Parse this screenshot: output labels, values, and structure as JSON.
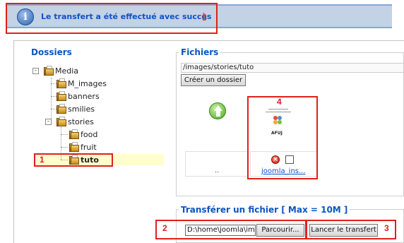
{
  "message": {
    "text": "Le transfert a été effectué avec succès",
    "icon": "info-icon"
  },
  "annotations": [
    "1",
    "2",
    "3",
    "4",
    "5"
  ],
  "dossiers": {
    "title": "Dossiers",
    "tree": {
      "root": "Media",
      "m_images": "M_images",
      "banners": "banners",
      "smilies": "smilies",
      "stories": "stories",
      "food": "food",
      "fruit": "fruit",
      "tuto": "tuto"
    }
  },
  "fichiers": {
    "title": "Fichiers",
    "path": "/images/stories/tuto",
    "create_folder": "Créer un dossier",
    "up_label": "..",
    "file_name": "joomla_ins...",
    "thumb_text": "AFUJ"
  },
  "upload": {
    "title": "Transférer un fichier [ Max = 10M ]",
    "input_value": "D:\\home\\joomla\\images\\",
    "browse": "Parcourir...",
    "start": "Lancer le transfert"
  },
  "colors": {
    "link_blue": "#0b55c4",
    "annotation_red": "#e0201b",
    "message_bg": "#c3d2e5"
  }
}
